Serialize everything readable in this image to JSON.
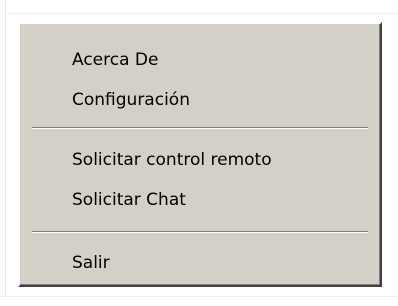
{
  "context_menu": {
    "items": [
      {
        "label": "Acerca De"
      },
      {
        "label": "Configuración"
      },
      {
        "label": "Solicitar control remoto"
      },
      {
        "label": "Solicitar Chat"
      },
      {
        "label": "Salir"
      }
    ]
  }
}
